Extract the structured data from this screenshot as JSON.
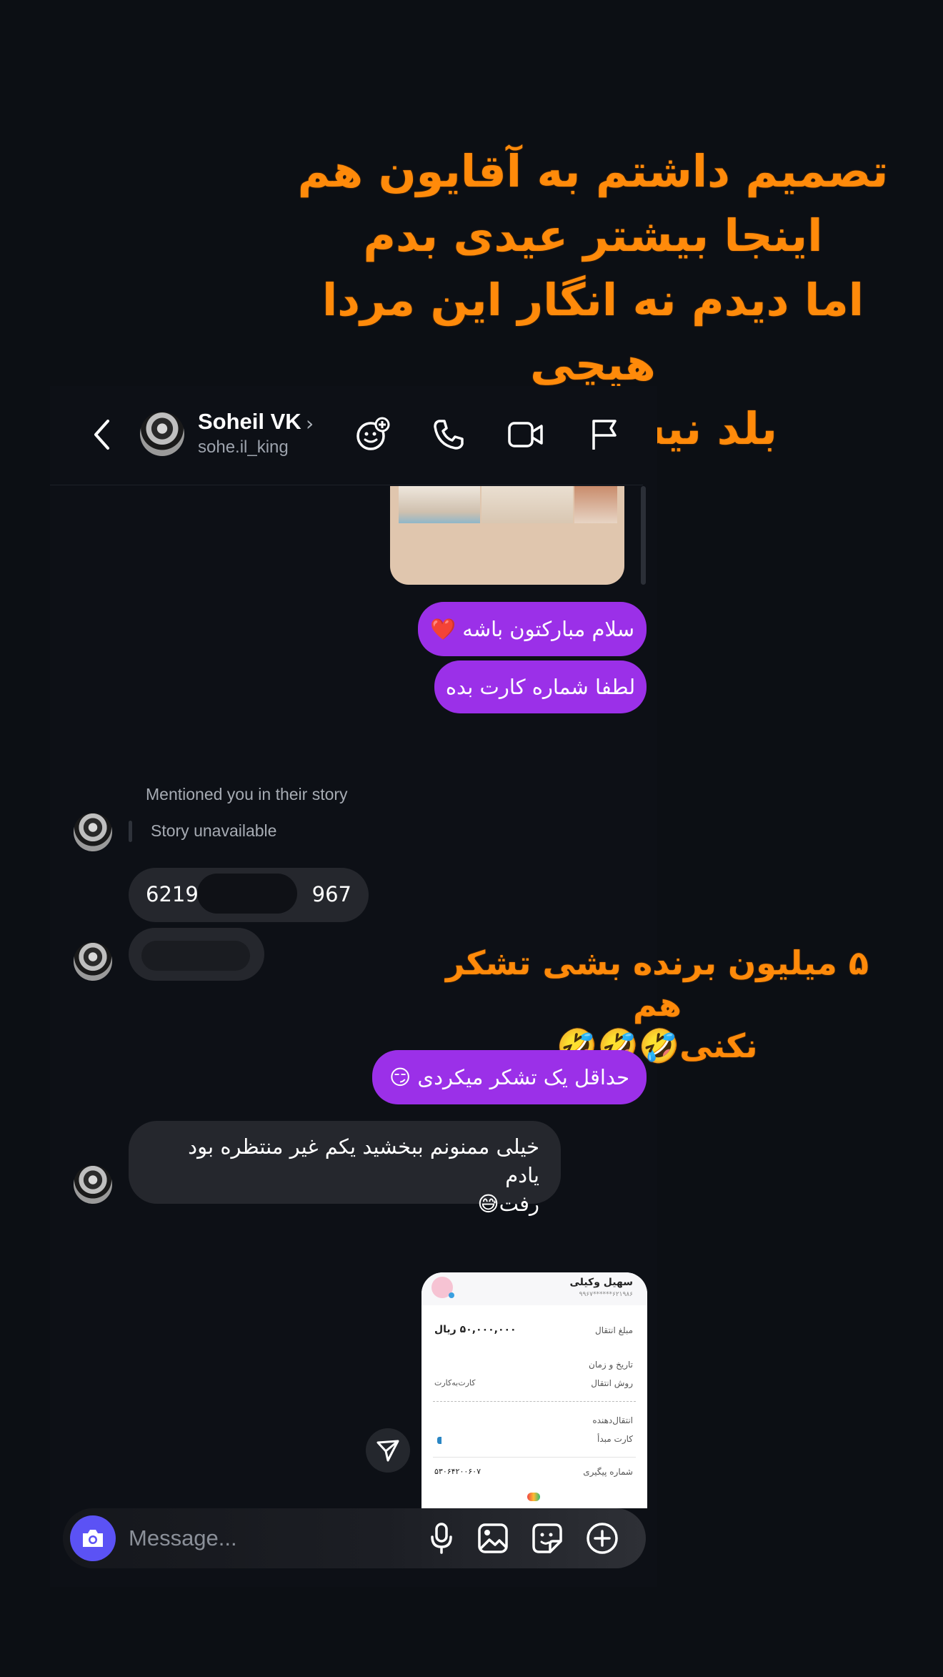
{
  "caption_top": {
    "line1": "تصمیم داشتم به آقایون هم",
    "line2": "اینجا بیشتر عیدی بدم",
    "line3": "اما دیدم نه انگار این مردا هیچی",
    "line4": "بلد نیستن😂😂😂"
  },
  "caption_mid": {
    "line1": "۵ میلیون برنده بشی تشکر هم",
    "line2": "نکنی🤣🤣🤣"
  },
  "header": {
    "name": "Soheil VK",
    "username": "sohe.il_king"
  },
  "messages": {
    "out1": "سلام مبارکتون باشه ❤️",
    "out2": "لطفا شماره کارت بده",
    "story_mention": "Mentioned you in their story",
    "story_unavailable": "Story unavailable",
    "card_number_start": "6219",
    "card_number_end": "967",
    "out3": "حداقل یک تشکر میکردی 😏",
    "in_reply_line1": "خیلی ممنونم ببخشید یکم غیر منتظره بود یادم",
    "in_reply_line2": "رفت😅"
  },
  "receipt": {
    "sender_name": "سهیل وکیلی",
    "masked_card": "۶۲۱۹۸۶******۹۹۶۷",
    "amount_label": "مبلغ انتقال",
    "amount_value": "۵۰,۰۰۰,۰۰۰ ریال",
    "datetime_label": "تاریخ و زمان",
    "method_label": "روش انتقال",
    "method_value": "کارت‌به‌کارت",
    "sender_label": "انتقال‌دهنده",
    "source_card_label": "کارت مبدأ",
    "tracking_label": "شماره پیگیری",
    "tracking_value": "۵۳۰۶۴۲۰۰۶۰۷"
  },
  "composer": {
    "placeholder": "Message..."
  },
  "colors": {
    "background": "#0c0f14",
    "outgoing_bubble": "#9b30e8",
    "incoming_bubble": "#25272d",
    "caption": "#ff8a0a",
    "camera_button": "#5b52f5"
  }
}
